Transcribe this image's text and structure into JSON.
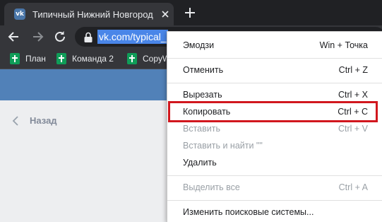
{
  "browser": {
    "tab": {
      "title": "Типичный Нижний Новгород",
      "favicon_text": "vk"
    },
    "address_bar": {
      "url": "vk.com/typical_"
    },
    "bookmarks": [
      {
        "label": "План"
      },
      {
        "label": "Команда 2"
      },
      {
        "label": "CopyW"
      }
    ]
  },
  "page": {
    "back_label": "Назад",
    "accent_color": "#5181b8"
  },
  "context_menu": {
    "items": [
      {
        "label": "Эмодзи",
        "shortcut": "Win + Точка",
        "enabled": true
      },
      {
        "label": "Отменить",
        "shortcut": "Ctrl + Z",
        "enabled": true
      },
      {
        "label": "Вырезать",
        "shortcut": "Ctrl + X",
        "enabled": true
      },
      {
        "label": "Копировать",
        "shortcut": "Ctrl + C",
        "enabled": true,
        "highlighted": true
      },
      {
        "label": "Вставить",
        "shortcut": "Ctrl + V",
        "enabled": false
      },
      {
        "label": "Вставить и найти \"\"",
        "shortcut": "",
        "enabled": false
      },
      {
        "label": "Удалить",
        "shortcut": "",
        "enabled": true
      },
      {
        "label": "Выделить все",
        "shortcut": "Ctrl + A",
        "enabled": false
      },
      {
        "label": "Изменить поисковые системы...",
        "shortcut": "",
        "enabled": true
      }
    ],
    "highlight_color": "#d1171e"
  }
}
